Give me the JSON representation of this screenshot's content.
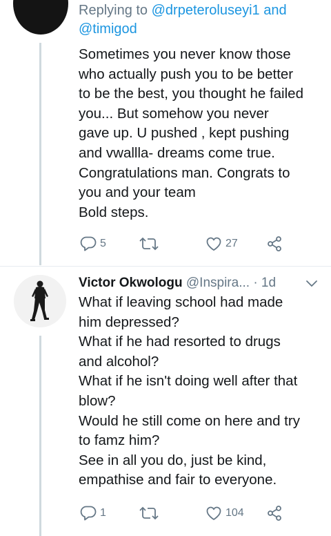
{
  "tweet1": {
    "replying_prefix": "Replying to",
    "replying_handles": "@drpeteroluseyi1 and @timigod",
    "lines": [
      "Sometimes you never know those",
      "who actually push you to be better",
      "to be the best, you thought he failed",
      "you...  But somehow you never",
      "gave up. U pushed , kept pushing",
      "and vwallla- dreams come true.",
      "Congratulations man. Congrats to",
      "you and your team",
      "Bold steps."
    ],
    "reply_count": "5",
    "retweet_count": "",
    "like_count": "27"
  },
  "tweet2": {
    "name": "Victor Okwologu",
    "username": "@Inspira...",
    "time": "· 1d",
    "lines": [
      "What if leaving school had made",
      "him depressed?",
      "What if he had resorted to drugs",
      "and alcohol?",
      "What if he isn't doing well after that",
      "blow?",
      "Would he still come on here and try",
      "to famz him?",
      "See in all you do, just be kind,",
      "empathise and fair to everyone."
    ],
    "reply_count": "1",
    "retweet_count": "",
    "like_count": "104"
  },
  "icons": {
    "reply": "reply-icon",
    "retweet": "retweet-icon",
    "like": "heart-icon",
    "share": "share-icon",
    "menu": "chevron-down-icon"
  },
  "colors": {
    "link": "#1b95e0",
    "secondary_text": "#657786",
    "primary_text": "#14171a",
    "thread_line": "#cfd9de"
  }
}
